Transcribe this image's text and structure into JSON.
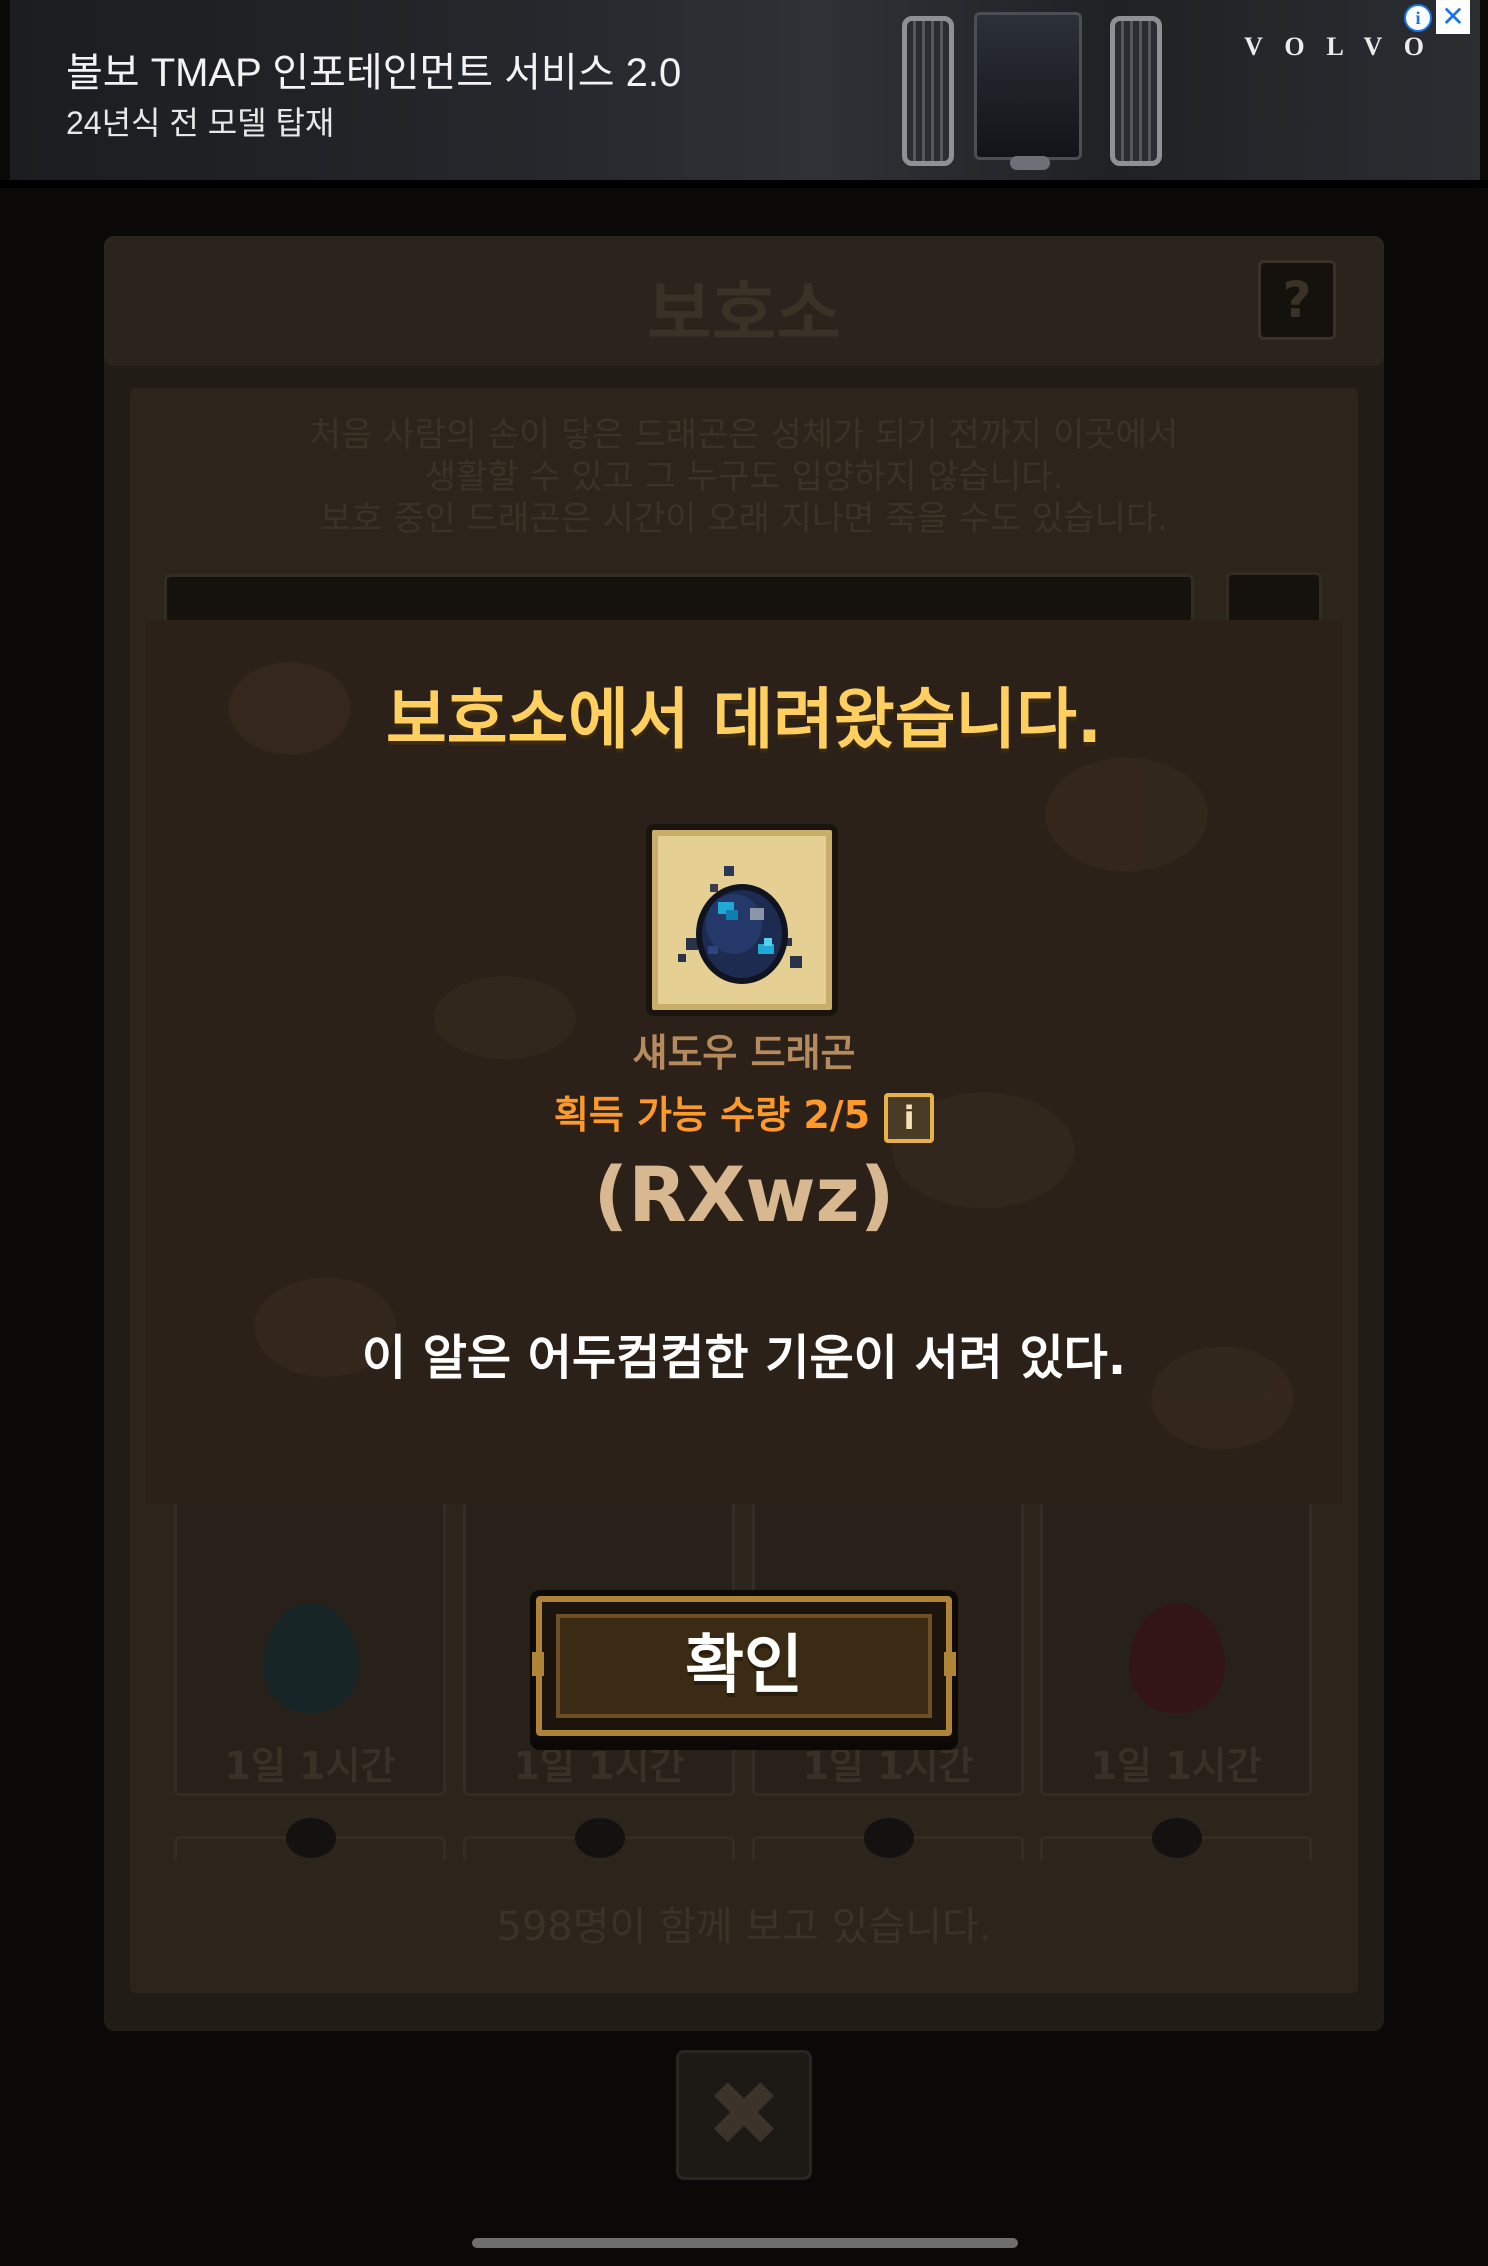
{
  "ad": {
    "title": "볼보 TMAP 인포테인먼트 서비스 2.0",
    "subtitle": "24년식 전 모델 탑재",
    "brand": "VOLVO",
    "info_icon": "info-icon",
    "close_icon": "close-icon"
  },
  "background": {
    "title": "보호소",
    "help": "?",
    "description": [
      "처음 사람의 손이 닿은 드래곤은 성체가 되기 전까지 이곳에서",
      "생활할 수 있고 그 누구도 입양하지 않습니다.",
      "보호 중인 드래곤은 시간이 오래 지나면 죽을 수도 있습니다."
    ],
    "cards": [
      {
        "time": "1일 1시간",
        "egg_color": "#1b2a2c"
      },
      {
        "time": "1일 1시간",
        "egg_color": "#1b1b1b"
      },
      {
        "time": "1일 1시간",
        "egg_color": "#1b1b1b"
      },
      {
        "time": "1일 1시간",
        "egg_color": "#3a1616"
      }
    ],
    "watching": "598명이 함께 보고 있습니다.",
    "close": "✖"
  },
  "modal": {
    "title": "보호소에서 데려왔습니다.",
    "item_name": "섀도우 드래곤",
    "acquire_label": "획득 가능 수량 2/5",
    "info_icon": "i",
    "code": "(RXwz)",
    "description": "이 알은 어두컴컴한 기운이 서려 있다."
  },
  "confirm_button": {
    "label": "확인"
  },
  "colors": {
    "title": "#ffd060",
    "acquire": "#ff9a2a",
    "modal_bg": "#2b2118",
    "button_border": "#b08436"
  }
}
